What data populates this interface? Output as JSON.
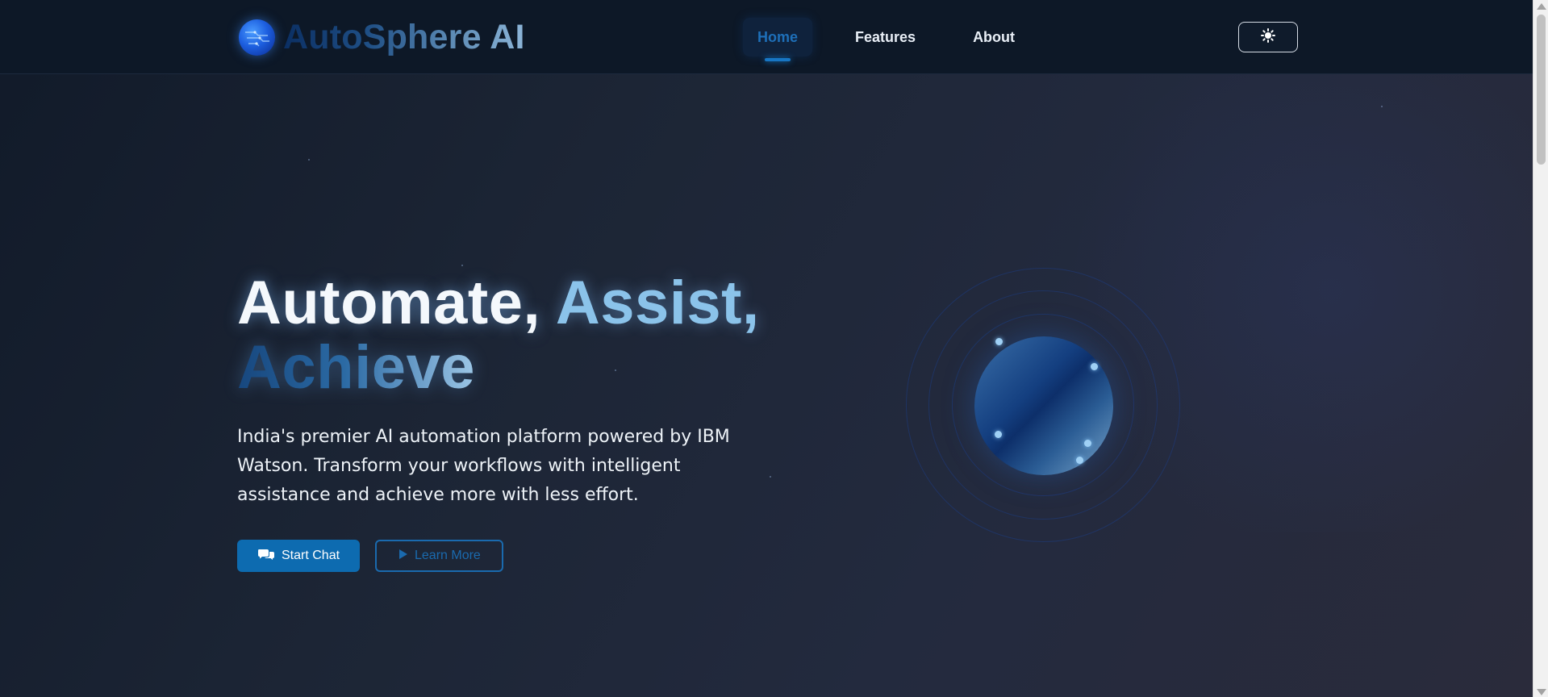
{
  "header": {
    "brand": "AutoSphere AI",
    "logo_icon": "globe-circuit-icon",
    "nav": [
      {
        "label": "Home",
        "active": true
      },
      {
        "label": "Features",
        "active": false
      },
      {
        "label": "About",
        "active": false
      }
    ],
    "theme_toggle_icon": "sun-icon"
  },
  "hero": {
    "title_word1": "Automate,",
    "title_word2": "Assist,",
    "title_word3": "Achieve",
    "description": "India's premier AI automation platform powered by IBM Watson. Transform your workflows with intelligent assistance and achieve more with less effort.",
    "primary_button": {
      "label": "Start Chat",
      "icon": "comments-icon"
    },
    "secondary_button": {
      "label": "Learn More",
      "icon": "play-icon"
    }
  },
  "colors": {
    "accent": "#0d6bb0",
    "active_nav": "#1e6fb8",
    "title_highlight": "#8bc3ea"
  }
}
